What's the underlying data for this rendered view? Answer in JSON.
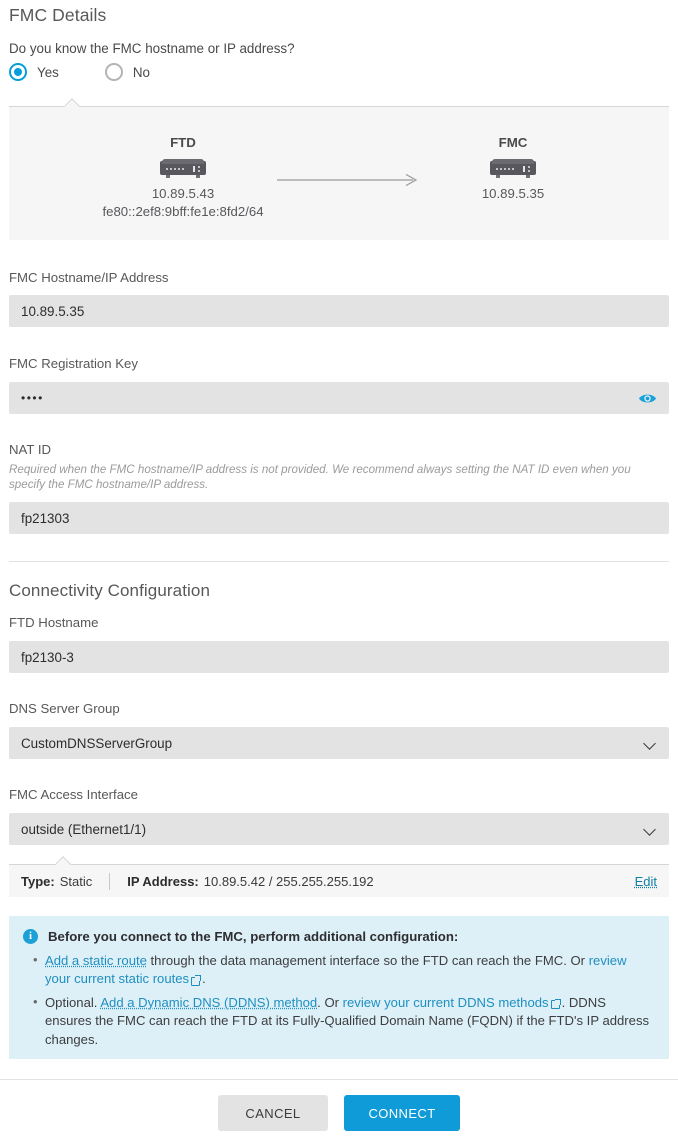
{
  "header": {
    "title": "FMC Details",
    "question": "Do you know the FMC hostname or IP address?"
  },
  "radios": {
    "yes_label": "Yes",
    "no_label": "No",
    "selected": "Yes"
  },
  "diagram": {
    "left": {
      "title": "FTD",
      "ipv4": "10.89.5.43",
      "ipv6": "fe80::2ef8:9bff:fe1e:8fd2/64"
    },
    "right": {
      "title": "FMC",
      "ipv4": "10.89.5.35"
    }
  },
  "fields": {
    "hostname": {
      "label": "FMC Hostname/IP Address",
      "value": "10.89.5.35"
    },
    "registration_key": {
      "label": "FMC Registration Key",
      "value": "••••",
      "reveal_icon": "eye-icon"
    },
    "nat_id": {
      "label": "NAT ID",
      "help": "Required when the FMC hostname/IP address is not provided. We recommend always setting the NAT ID even when you specify the FMC hostname/IP address.",
      "value": "fp21303"
    }
  },
  "connectivity": {
    "title": "Connectivity Configuration",
    "ftd_hostname": {
      "label": "FTD Hostname",
      "value": "fp2130-3"
    },
    "dns_server_group": {
      "label": "DNS Server Group",
      "value": "CustomDNSServerGroup"
    },
    "fmc_access_interface": {
      "label": "FMC Access Interface",
      "value": "outside (Ethernet1/1)"
    },
    "interface_info": {
      "type_label": "Type:",
      "type_value": "Static",
      "ip_label": "IP Address:",
      "ip_value": "10.89.5.42 / 255.255.255.192",
      "edit_label": "Edit"
    }
  },
  "banner": {
    "icon": "info-icon",
    "heading": "Before you connect to the FMC, perform additional configuration:",
    "bullet1": {
      "link1": "Add a static route",
      "text1": " through the data management interface so the FTD can reach the FMC. Or ",
      "link2": "review your current static routes",
      "text2": "."
    },
    "bullet2": {
      "text0": "Optional. ",
      "link1": "Add a Dynamic DNS (DDNS) method",
      "text1": ". Or ",
      "link2": "review your current DDNS methods",
      "text2": ". DDNS ensures the FMC can reach the FTD at its Fully-Qualified Domain Name (FQDN) if the FTD's IP address changes."
    }
  },
  "footer": {
    "cancel_label": "CANCEL",
    "connect_label": "CONNECT"
  },
  "colors": {
    "accent": "#049fd9",
    "primary_button": "#0f9bd7",
    "banner_bg": "#ddf0f8",
    "link": "#1f8fc0",
    "input_bg": "#e3e3e3"
  }
}
